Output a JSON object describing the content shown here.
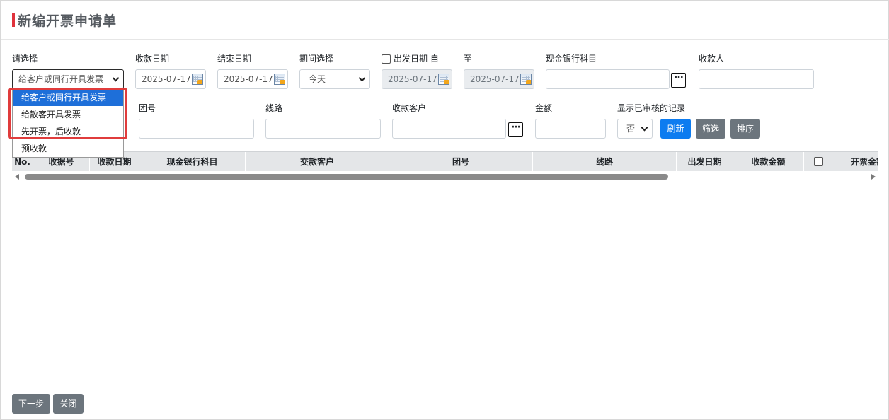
{
  "title": "新编开票申请单",
  "filters": {
    "select_label": "请选择",
    "select_value": "给客户或同行开具发票",
    "receive_date_label": "收款日期",
    "receive_date_value": "2025-07-17",
    "end_date_label": "结束日期",
    "end_date_value": "2025-07-17",
    "period_label": "期间选择",
    "period_value": "今天",
    "depart_date_label": "出发日期 自",
    "depart_from_value": "2025-07-17",
    "to_label": "至",
    "depart_to_value": "2025-07-17",
    "bank_label": "现金银行科目",
    "bank_value": "",
    "payee_label": "收款人",
    "payee_value": "",
    "group_label": "团号",
    "group_value": "",
    "route_label": "线路",
    "route_value": "",
    "customer_label": "收款客户",
    "customer_value": "",
    "amount_label": "金额",
    "amount_value": "",
    "show_audited_label": "显示已审核的记录",
    "show_audited_value": "否",
    "refresh_label": "刷新",
    "filter_label": "筛选",
    "sort_label": "排序",
    "dots": "···"
  },
  "dropdown": {
    "options": [
      "给客户或同行开具发票",
      "给散客开具发票",
      "先开票，后收款",
      "预收款"
    ],
    "selected_index": 0
  },
  "table": {
    "columns": [
      "No.",
      "收据号",
      "收款日期",
      "现金银行科目",
      "交款客户",
      "团号",
      "线路",
      "出发日期",
      "收款金额",
      "",
      "开票金额"
    ]
  },
  "footer": {
    "next_label": "下一步",
    "close_label": "关闭"
  },
  "colors": {
    "accent_red": "#e0323c",
    "primary_blue": "#0d7cf0",
    "secondary_gray": "#6c757d",
    "dropdown_selected": "#1e6fd9"
  }
}
